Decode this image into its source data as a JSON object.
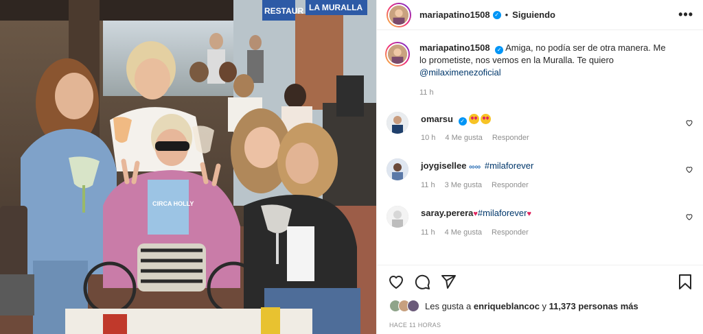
{
  "post": {
    "author": "mariapatino1508",
    "follow_state": "Siguiendo",
    "separator": "•",
    "more_label": "•••"
  },
  "photo": {
    "sign_1": "RESTAUR",
    "sign_2": "LA MURALLA",
    "shirt_text": "CIRCA HOLLY"
  },
  "caption": {
    "username": "mariapatino1508",
    "text": "Amiga, no podía ser de otra manera. Me lo prometiste, nos vemos en la Muralla. Te quiero",
    "mention": "@milaximenezoficial",
    "time": "11 h"
  },
  "comments": [
    {
      "username": "omarsu",
      "verified": true,
      "text": "",
      "time": "10 h",
      "likes": "4 Me gusta",
      "reply": "Responder"
    },
    {
      "username": "joygisellee",
      "verified": false,
      "text": "#milaforever",
      "time": "11 h",
      "likes": "3 Me gusta",
      "reply": "Responder"
    },
    {
      "username": "saray.perera",
      "verified": false,
      "text_pre": "♥",
      "text": "#milaforever",
      "text_post": "♥",
      "time": "11 h",
      "likes": "4 Me gusta",
      "reply": "Responder"
    }
  ],
  "likes": {
    "prefix": "Les gusta a",
    "user": "enriqueblancoc",
    "middle": "y",
    "count": "11,373 personas más"
  },
  "posted": "HACE 11 HORAS",
  "icons": [
    "heart-icon",
    "comment-icon",
    "share-icon",
    "bookmark-icon",
    "verified-icon",
    "more-icon"
  ]
}
